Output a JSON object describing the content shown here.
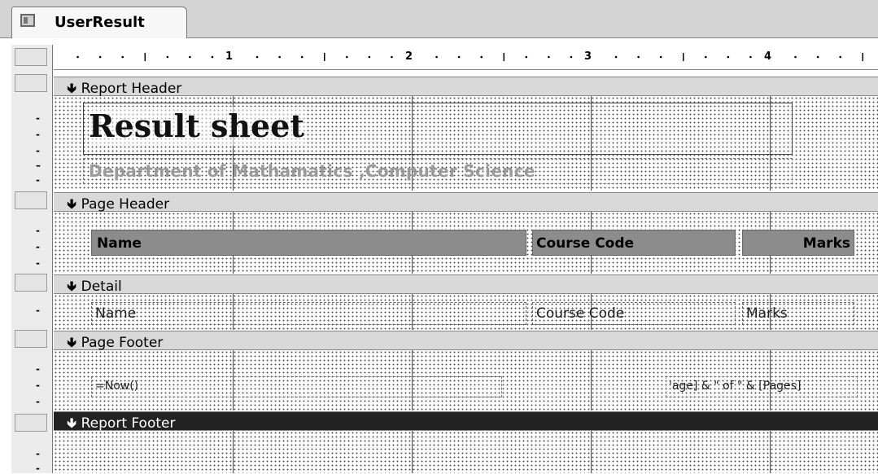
{
  "tab": {
    "title": "UserResult"
  },
  "ruler": {
    "marks": [
      "1",
      "2",
      "3",
      "4"
    ]
  },
  "sections": {
    "report_header": "Report Header",
    "page_header": "Page Header",
    "detail": "Detail",
    "page_footer": "Page Footer",
    "report_footer": "Report Footer"
  },
  "report_header": {
    "title": "Result sheet",
    "subtitle": "Department of Mathamatics ,Computer Science"
  },
  "page_header": {
    "col_name": "Name",
    "col_course": "Course Code",
    "col_marks": "Marks"
  },
  "detail": {
    "name": "Name",
    "course": "Course Code",
    "marks": "Marks"
  },
  "page_footer": {
    "now": "=Now()",
    "pages": "'age] & \" of \" & [Pages]"
  },
  "arrow_glyph": "🢃"
}
